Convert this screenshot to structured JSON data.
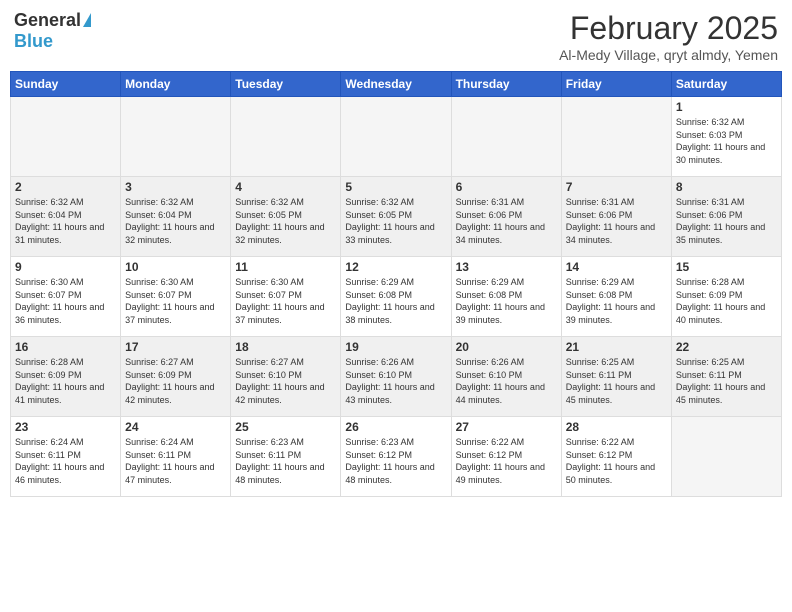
{
  "header": {
    "logo_general": "General",
    "logo_blue": "Blue",
    "month_title": "February 2025",
    "location": "Al-Medy Village, qryt almdy, Yemen"
  },
  "weekdays": [
    "Sunday",
    "Monday",
    "Tuesday",
    "Wednesday",
    "Thursday",
    "Friday",
    "Saturday"
  ],
  "weeks": [
    [
      {
        "day": "",
        "info": ""
      },
      {
        "day": "",
        "info": ""
      },
      {
        "day": "",
        "info": ""
      },
      {
        "day": "",
        "info": ""
      },
      {
        "day": "",
        "info": ""
      },
      {
        "day": "",
        "info": ""
      },
      {
        "day": "1",
        "info": "Sunrise: 6:32 AM\nSunset: 6:03 PM\nDaylight: 11 hours and 30 minutes."
      }
    ],
    [
      {
        "day": "2",
        "info": "Sunrise: 6:32 AM\nSunset: 6:04 PM\nDaylight: 11 hours and 31 minutes."
      },
      {
        "day": "3",
        "info": "Sunrise: 6:32 AM\nSunset: 6:04 PM\nDaylight: 11 hours and 32 minutes."
      },
      {
        "day": "4",
        "info": "Sunrise: 6:32 AM\nSunset: 6:05 PM\nDaylight: 11 hours and 32 minutes."
      },
      {
        "day": "5",
        "info": "Sunrise: 6:32 AM\nSunset: 6:05 PM\nDaylight: 11 hours and 33 minutes."
      },
      {
        "day": "6",
        "info": "Sunrise: 6:31 AM\nSunset: 6:06 PM\nDaylight: 11 hours and 34 minutes."
      },
      {
        "day": "7",
        "info": "Sunrise: 6:31 AM\nSunset: 6:06 PM\nDaylight: 11 hours and 34 minutes."
      },
      {
        "day": "8",
        "info": "Sunrise: 6:31 AM\nSunset: 6:06 PM\nDaylight: 11 hours and 35 minutes."
      }
    ],
    [
      {
        "day": "9",
        "info": "Sunrise: 6:30 AM\nSunset: 6:07 PM\nDaylight: 11 hours and 36 minutes."
      },
      {
        "day": "10",
        "info": "Sunrise: 6:30 AM\nSunset: 6:07 PM\nDaylight: 11 hours and 37 minutes."
      },
      {
        "day": "11",
        "info": "Sunrise: 6:30 AM\nSunset: 6:07 PM\nDaylight: 11 hours and 37 minutes."
      },
      {
        "day": "12",
        "info": "Sunrise: 6:29 AM\nSunset: 6:08 PM\nDaylight: 11 hours and 38 minutes."
      },
      {
        "day": "13",
        "info": "Sunrise: 6:29 AM\nSunset: 6:08 PM\nDaylight: 11 hours and 39 minutes."
      },
      {
        "day": "14",
        "info": "Sunrise: 6:29 AM\nSunset: 6:08 PM\nDaylight: 11 hours and 39 minutes."
      },
      {
        "day": "15",
        "info": "Sunrise: 6:28 AM\nSunset: 6:09 PM\nDaylight: 11 hours and 40 minutes."
      }
    ],
    [
      {
        "day": "16",
        "info": "Sunrise: 6:28 AM\nSunset: 6:09 PM\nDaylight: 11 hours and 41 minutes."
      },
      {
        "day": "17",
        "info": "Sunrise: 6:27 AM\nSunset: 6:09 PM\nDaylight: 11 hours and 42 minutes."
      },
      {
        "day": "18",
        "info": "Sunrise: 6:27 AM\nSunset: 6:10 PM\nDaylight: 11 hours and 42 minutes."
      },
      {
        "day": "19",
        "info": "Sunrise: 6:26 AM\nSunset: 6:10 PM\nDaylight: 11 hours and 43 minutes."
      },
      {
        "day": "20",
        "info": "Sunrise: 6:26 AM\nSunset: 6:10 PM\nDaylight: 11 hours and 44 minutes."
      },
      {
        "day": "21",
        "info": "Sunrise: 6:25 AM\nSunset: 6:11 PM\nDaylight: 11 hours and 45 minutes."
      },
      {
        "day": "22",
        "info": "Sunrise: 6:25 AM\nSunset: 6:11 PM\nDaylight: 11 hours and 45 minutes."
      }
    ],
    [
      {
        "day": "23",
        "info": "Sunrise: 6:24 AM\nSunset: 6:11 PM\nDaylight: 11 hours and 46 minutes."
      },
      {
        "day": "24",
        "info": "Sunrise: 6:24 AM\nSunset: 6:11 PM\nDaylight: 11 hours and 47 minutes."
      },
      {
        "day": "25",
        "info": "Sunrise: 6:23 AM\nSunset: 6:11 PM\nDaylight: 11 hours and 48 minutes."
      },
      {
        "day": "26",
        "info": "Sunrise: 6:23 AM\nSunset: 6:12 PM\nDaylight: 11 hours and 48 minutes."
      },
      {
        "day": "27",
        "info": "Sunrise: 6:22 AM\nSunset: 6:12 PM\nDaylight: 11 hours and 49 minutes."
      },
      {
        "day": "28",
        "info": "Sunrise: 6:22 AM\nSunset: 6:12 PM\nDaylight: 11 hours and 50 minutes."
      },
      {
        "day": "",
        "info": ""
      }
    ]
  ]
}
